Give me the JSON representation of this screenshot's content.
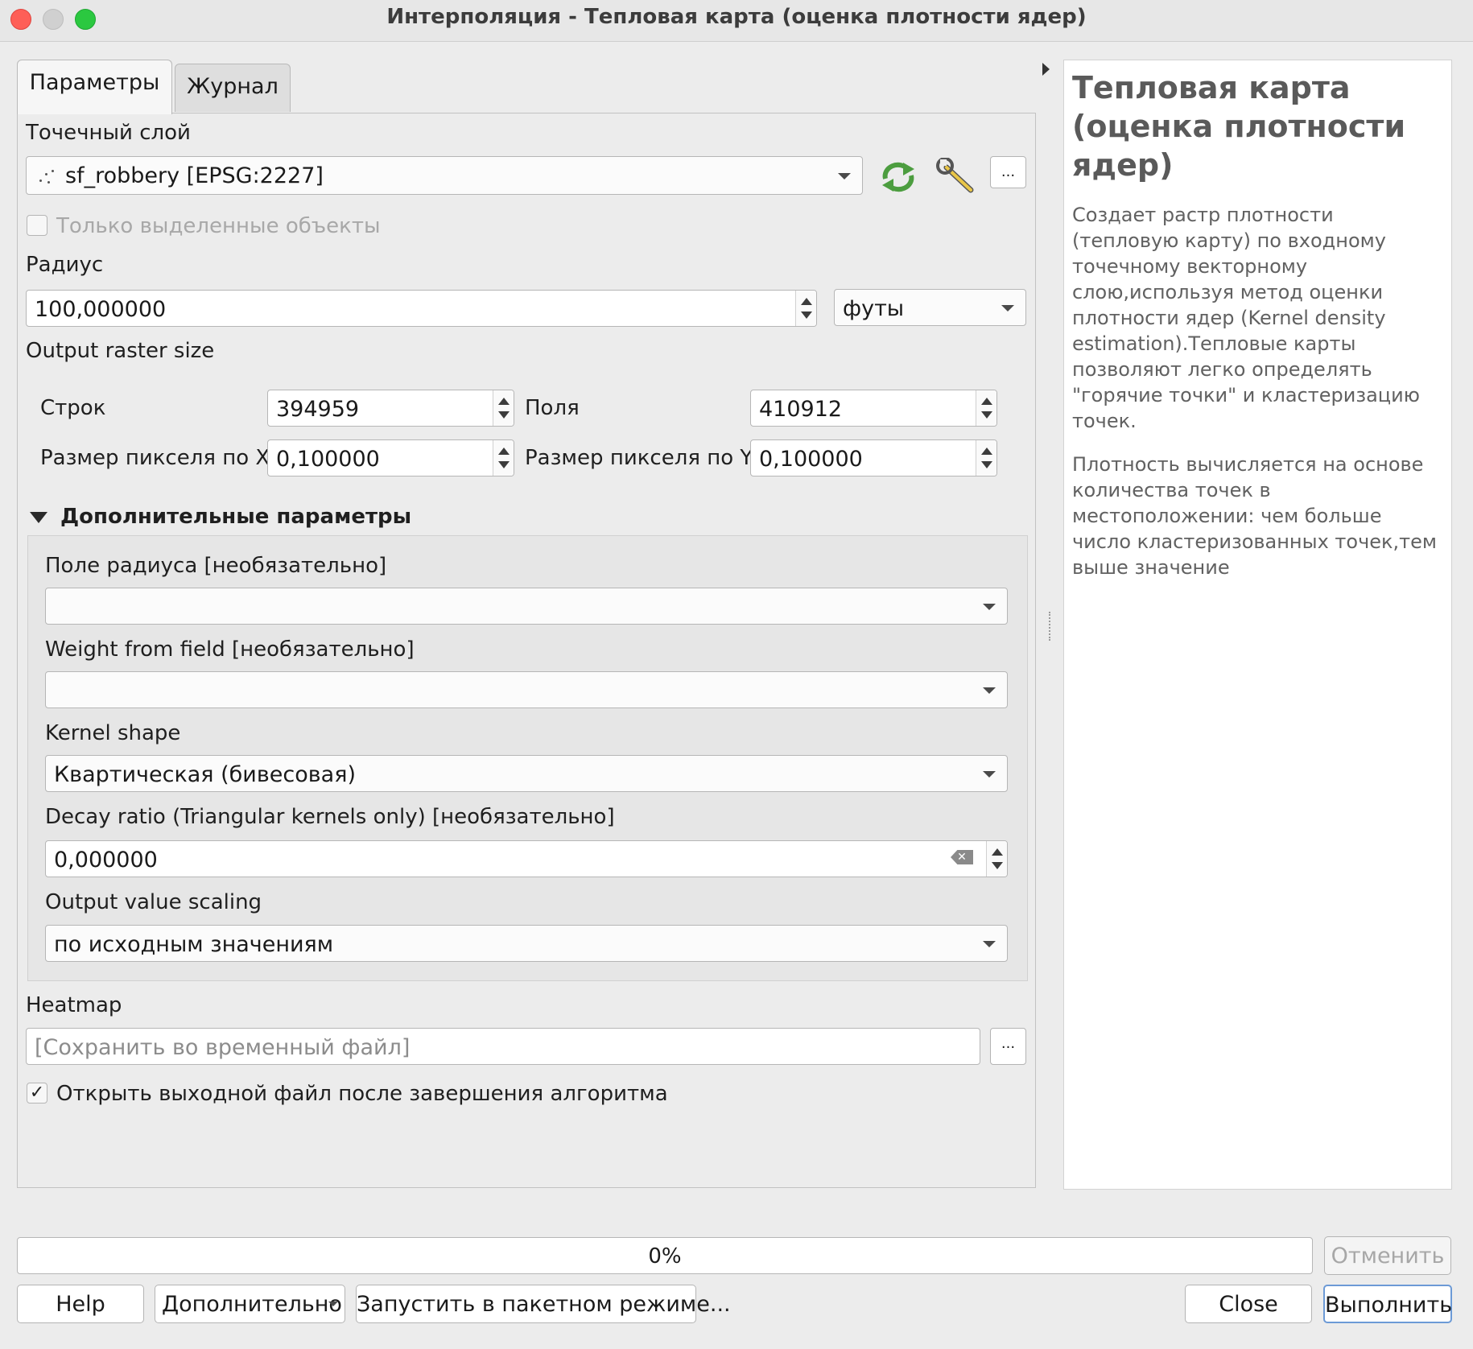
{
  "window": {
    "title": "Интерполяция - Тепловая карта (оценка плотности ядер)"
  },
  "tabs": [
    {
      "label": "Параметры"
    },
    {
      "label": "Журнал"
    }
  ],
  "params": {
    "point_layer_label": "Точечный слой",
    "point_layer_value": "sf_robbery [EPSG:2227]",
    "selected_only_label": "Только выделенные объекты",
    "radius_label": "Радиус",
    "radius_value": "100,000000",
    "radius_unit": "футы",
    "output_raster_size_label": "Output raster size",
    "rows_label": "Строк",
    "rows_value": "394959",
    "columns_label": "Поля",
    "columns_value": "410912",
    "pixel_x_label": "Размер пикселя по X",
    "pixel_x_value": "0,100000",
    "pixel_y_label": "Размер пикселя по Y",
    "pixel_y_value": "0,100000",
    "dots": "..."
  },
  "advanced": {
    "header": "Дополнительные параметры",
    "radius_field_label": "Поле радиуса [необязательно]",
    "radius_field_value": "",
    "weight_field_label": "Weight from field [необязательно]",
    "weight_field_value": "",
    "kernel_shape_label": "Kernel shape",
    "kernel_shape_value": "Квартическая (бивесовая)",
    "decay_ratio_label": "Decay ratio (Triangular kernels only) [необязательно]",
    "decay_ratio_value": "0,000000",
    "output_scaling_label": "Output value scaling",
    "output_scaling_value": "по исходным значениям"
  },
  "output": {
    "heatmap_label": "Heatmap",
    "heatmap_placeholder": "[Сохранить во временный файл]",
    "open_output_label": "Открыть выходной файл после завершения алгоритма",
    "open_output_checked": true
  },
  "help": {
    "title": "Тепловая карта (оценка плотности ядер)",
    "p1": "Создает растр плотности (тепловую карту) по входному точечному векторному слою,используя метод оценки плотности ядер (Kernel density estimation).Тепловые карты позволяют легко определять \"горячие точки\" и кластеризацию точек.",
    "p2": "Плотность вычисляется на основе количества точек в местоположении: чем больше число кластеризованных точек,тем выше значение"
  },
  "footer": {
    "progress_text": "0%",
    "progress_fraction": 0,
    "cancel_label": "Отменить",
    "help_label": "Help",
    "advanced_label": "Дополнительно",
    "batch_label": "Запустить в пакетном режиме...",
    "close_label": "Close",
    "run_label": "Выполнить"
  },
  "icons": {
    "refresh": "iterate-icon",
    "settings": "wrench-icon",
    "layer": "point-layer-icon"
  },
  "colors": {
    "accent": "#6c9ad6",
    "refresh_green": "#4caf50"
  }
}
